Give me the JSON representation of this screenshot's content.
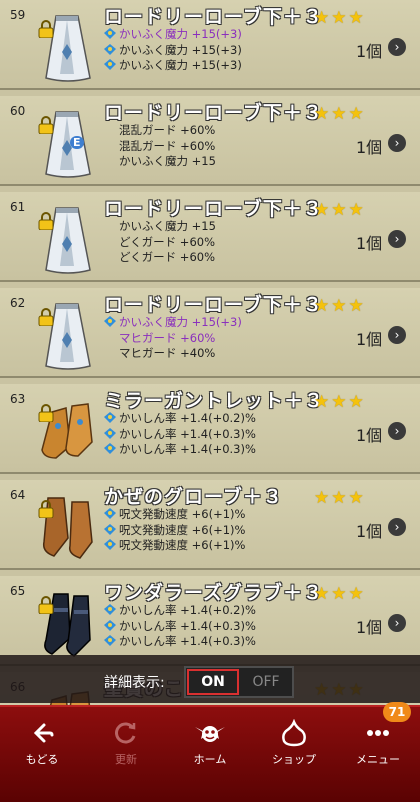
{
  "items": [
    {
      "num": "59",
      "name": "ロードリーローブ下＋３",
      "qty": "1個",
      "stars": "★★★",
      "icon": "robe-icon",
      "locked": true,
      "stamp": "",
      "stats": [
        {
          "text": "かいふく魔力 +15(+3)",
          "purple": true,
          "gem": true
        },
        {
          "text": "かいふく魔力 +15(+3)",
          "purple": false,
          "gem": true
        },
        {
          "text": "かいふく魔力 +15(+3)",
          "purple": false,
          "gem": true
        }
      ]
    },
    {
      "num": "60",
      "name": "ロードリーローブ下＋３",
      "qty": "1個",
      "stars": "★★★",
      "icon": "robe-icon",
      "locked": true,
      "stamp": "E",
      "stats": [
        {
          "text": "混乱ガード +60%",
          "purple": false,
          "gem": false
        },
        {
          "text": "混乱ガード +60%",
          "purple": false,
          "gem": false
        },
        {
          "text": "かいふく魔力 +15",
          "purple": false,
          "gem": false
        }
      ]
    },
    {
      "num": "61",
      "name": "ロードリーローブ下＋３",
      "qty": "1個",
      "stars": "★★★",
      "icon": "robe-icon",
      "locked": true,
      "stamp": "",
      "stats": [
        {
          "text": "かいふく魔力 +15",
          "purple": false,
          "gem": false
        },
        {
          "text": "どくガード +60%",
          "purple": false,
          "gem": false
        },
        {
          "text": "どくガード +60%",
          "purple": false,
          "gem": false
        }
      ]
    },
    {
      "num": "62",
      "name": "ロードリーローブ下＋３",
      "qty": "1個",
      "stars": "★★★",
      "icon": "robe-icon",
      "locked": true,
      "stamp": "",
      "stats": [
        {
          "text": "かいふく魔力 +15(+3)",
          "purple": true,
          "gem": true
        },
        {
          "text": "マヒガード +60%",
          "purple": true,
          "gem": false
        },
        {
          "text": "マヒガード +40%",
          "purple": false,
          "gem": false
        }
      ]
    },
    {
      "num": "63",
      "name": "ミラーガントレット＋３",
      "qty": "1個",
      "stars": "★★★",
      "icon": "gauntlet-icon",
      "locked": true,
      "stamp": "",
      "stats": [
        {
          "text": "かいしん率 +1.4(+0.2)%",
          "purple": false,
          "gem": true
        },
        {
          "text": "かいしん率 +1.4(+0.3)%",
          "purple": false,
          "gem": true
        },
        {
          "text": "かいしん率 +1.4(+0.3)%",
          "purple": false,
          "gem": true
        }
      ]
    },
    {
      "num": "64",
      "name": "かぜのグローブ＋３",
      "qty": "1個",
      "stars": "★★★",
      "icon": "glove-icon",
      "locked": true,
      "stamp": "",
      "stats": [
        {
          "text": "呪文発動速度 +6(+1)%",
          "purple": false,
          "gem": true
        },
        {
          "text": "呪文発動速度 +6(+1)%",
          "purple": false,
          "gem": true
        },
        {
          "text": "呪文発動速度 +6(+1)%",
          "purple": false,
          "gem": true
        }
      ]
    },
    {
      "num": "65",
      "name": "ワンダラーズグラブ＋３",
      "qty": "1個",
      "stars": "★★★",
      "icon": "dark-glove-icon",
      "locked": true,
      "stamp": "",
      "stats": [
        {
          "text": "かいしん率 +1.4(+0.2)%",
          "purple": false,
          "gem": true
        },
        {
          "text": "かいしん率 +1.4(+0.3)%",
          "purple": false,
          "gem": true
        },
        {
          "text": "かいしん率 +1.4(+0.3)%",
          "purple": false,
          "gem": true
        }
      ]
    },
    {
      "num": "66",
      "name": "聖賢のこて",
      "qty": "",
      "stars": "★★★",
      "icon": "gauntlet-icon",
      "locked": false,
      "stamp": "",
      "stats": []
    }
  ],
  "toggle": {
    "label": "詳細表示:",
    "on": "ON",
    "off": "OFF",
    "state": "ON"
  },
  "nav": [
    {
      "label": "もどる",
      "icon": "back-arrow-icon",
      "disabled": false
    },
    {
      "label": "更新",
      "icon": "refresh-icon",
      "disabled": true
    },
    {
      "label": "ホーム",
      "icon": "home-dracky-icon",
      "disabled": false
    },
    {
      "label": "ショップ",
      "icon": "shop-slime-icon",
      "disabled": false
    },
    {
      "label": "メニュー",
      "icon": "more-dots-icon",
      "disabled": false
    }
  ],
  "badge": "71",
  "colors": {
    "accent_red": "#8d0e0e",
    "purple_text": "#8a2fbd",
    "star": "#f4c20d",
    "badge": "#f08a19"
  }
}
